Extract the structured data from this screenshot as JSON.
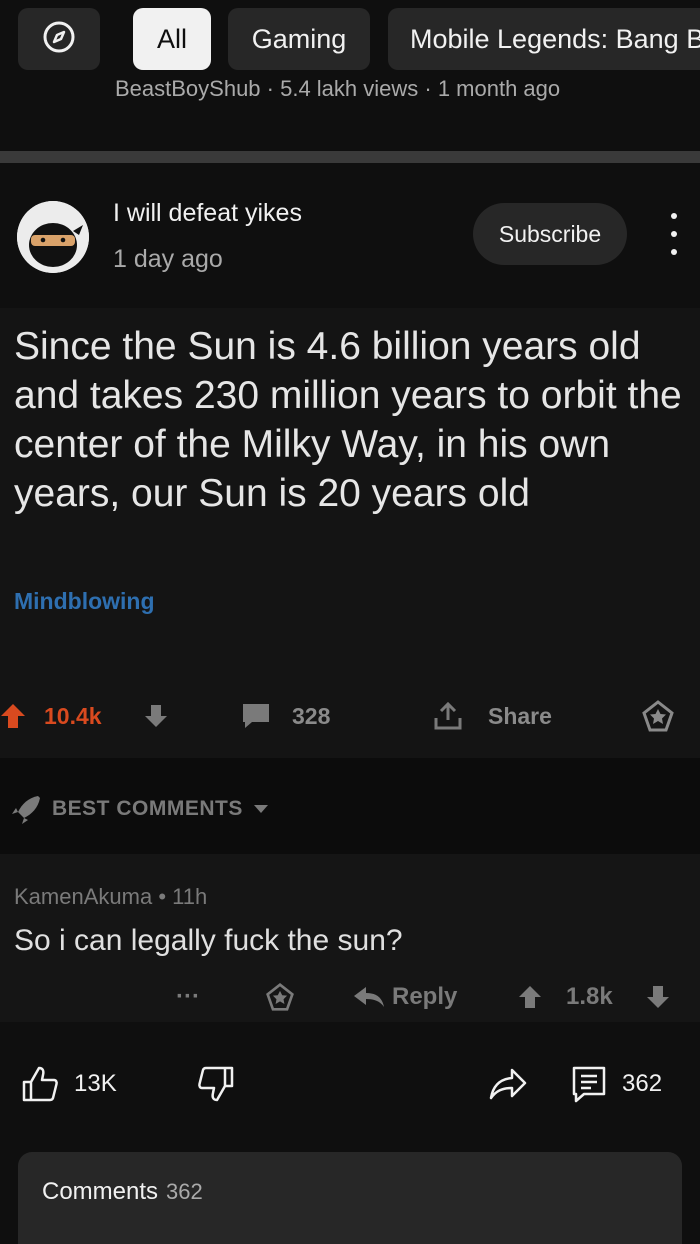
{
  "chips": {
    "explore_icon": "compass-icon",
    "items": [
      {
        "label": "All",
        "active": true
      },
      {
        "label": "Gaming",
        "active": false
      },
      {
        "label": "Mobile Legends: Bang B",
        "active": false
      }
    ]
  },
  "previous_video_meta": "BeastBoyShub · 5.4 lakh views · 1 month ago",
  "post": {
    "author": "I will defeat yikes",
    "time_ago": "1 day ago",
    "subscribe_label": "Subscribe",
    "more_icon": "kebab-icon"
  },
  "screenshot": {
    "title": "Since the Sun is 4.6 billion years old and takes 230 million years to orbit the center of the Milky Way, in his own years, our Sun is 20 years old",
    "flair": "Mindblowing",
    "upvotes": "10.4k",
    "comments": "328",
    "share_label": "Share",
    "best_comments_label": "BEST COMMENTS",
    "comment": {
      "user": "KamenAkuma",
      "time": "11h",
      "text": "So i can legally fuck the sun?",
      "more": "···",
      "reply_label": "Reply",
      "score": "1.8k"
    }
  },
  "yt_actions": {
    "likes": "13K",
    "comments_count": "362"
  },
  "comments_panel": {
    "label": "Comments",
    "count": "362"
  },
  "colors": {
    "background": "#0f0f0f",
    "chip": "#272727",
    "upvote": "#d94a1f",
    "flair": "#2e6fb0"
  }
}
